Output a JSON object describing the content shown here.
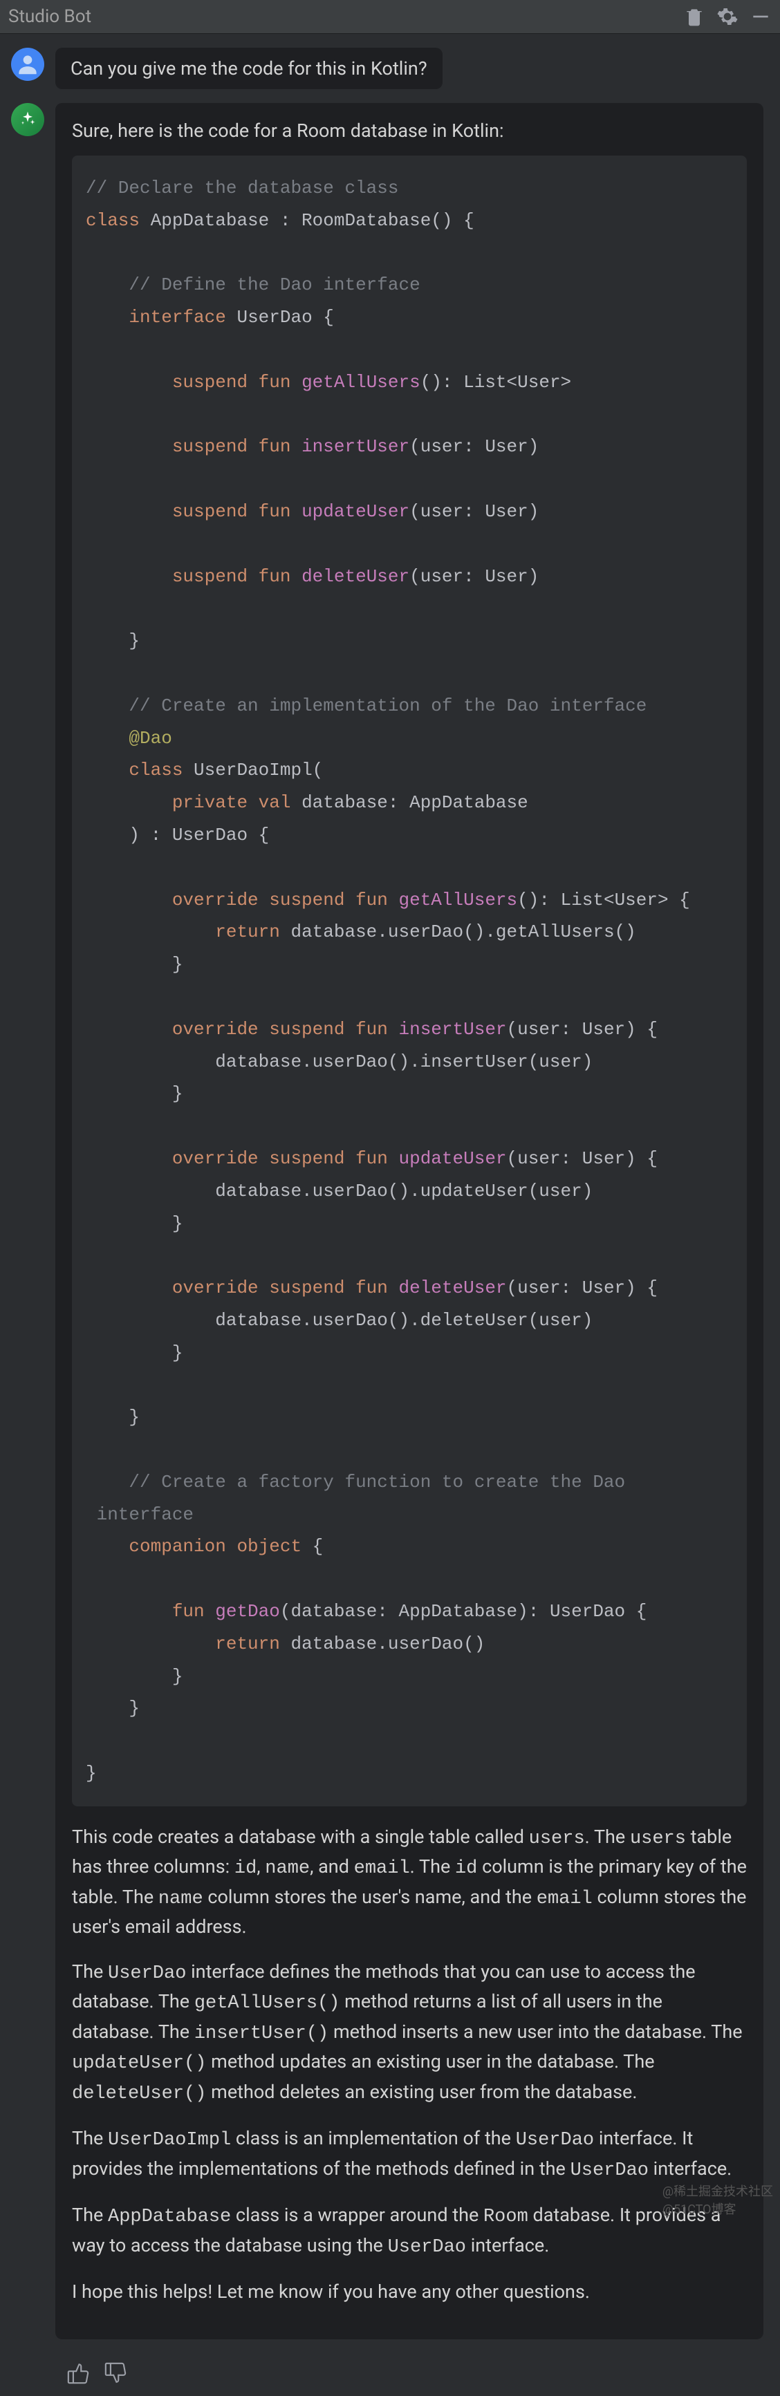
{
  "header": {
    "title": "Studio Bot"
  },
  "user": {
    "message": "Can you give me the code for this in Kotlin?"
  },
  "bot": {
    "intro": "Sure, here is the code for a Room database in Kotlin:",
    "code": {
      "l1": "// Declare the database class",
      "l2_kw": "class",
      "l2_name": "AppDatabase : RoomDatabase() {",
      "l3": "// Define the Dao interface",
      "l4_kw": "interface",
      "l4_name": "UserDao {",
      "l5_kw": "suspend fun",
      "l5_fn": "getAllUsers",
      "l5_rest": "(): List<User>",
      "l6_kw": "suspend fun",
      "l6_fn": "insertUser",
      "l6_rest": "(user: User)",
      "l7_kw": "suspend fun",
      "l7_fn": "updateUser",
      "l7_rest": "(user: User)",
      "l8_kw": "suspend fun",
      "l8_fn": "deleteUser",
      "l8_rest": "(user: User)",
      "l9": "}",
      "l10": "// Create an implementation of the Dao interface",
      "l11": "@Dao",
      "l12_kw": "class",
      "l12_name": "UserDaoImpl(",
      "l13_kw": "private val",
      "l13_rest": "database: AppDatabase",
      "l14": ") : UserDao {",
      "l15_kw": "override suspend fun",
      "l15_fn": "getAllUsers",
      "l15_rest": "(): List<User> {",
      "l16_kw": "return",
      "l16_rest": "database.userDao().getAllUsers()",
      "l17": "}",
      "l18_kw": "override suspend fun",
      "l18_fn": "insertUser",
      "l18_rest": "(user: User) {",
      "l19": "database.userDao().insertUser(user)",
      "l20": "}",
      "l21_kw": "override suspend fun",
      "l21_fn": "updateUser",
      "l21_rest": "(user: User) {",
      "l22": "database.userDao().updateUser(user)",
      "l23": "}",
      "l24_kw": "override suspend fun",
      "l24_fn": "deleteUser",
      "l24_rest": "(user: User) {",
      "l25": "database.userDao().deleteUser(user)",
      "l26": "}",
      "l27": "}",
      "l28a": "// Create a factory function to create the Dao",
      "l28b": " interface",
      "l29_kw": "companion object",
      "l29_rest": "{",
      "l30_kw": "fun",
      "l30_fn": "getDao",
      "l30_rest": "(database: AppDatabase): UserDao {",
      "l31_kw": "return",
      "l31_rest": "database.userDao()",
      "l32": "}",
      "l33": "}",
      "l34": "}"
    },
    "explanation": {
      "p1_a": "This code creates a database with a single table called ",
      "p1_b": "users",
      "p1_c": ". The ",
      "p1_d": "users",
      "p1_e": " table has three columns: ",
      "p1_f": "id",
      "p1_g": ", ",
      "p1_h": "name",
      "p1_i": ", and ",
      "p1_j": "email",
      "p1_k": ". The ",
      "p1_l": "id",
      "p1_m": " column is the primary key of the table. The ",
      "p1_n": "name",
      "p1_o": " column stores the user's name, and the ",
      "p1_p": "email",
      "p1_q": " column stores the user's email address.",
      "p2_a": "The ",
      "p2_b": "UserDao",
      "p2_c": " interface defines the methods that you can use to access the database. The ",
      "p2_d": "getAllUsers()",
      "p2_e": " method returns a list of all users in the database. The ",
      "p2_f": "insertUser()",
      "p2_g": " method inserts a new user into the database. The ",
      "p2_h": "updateUser()",
      "p2_i": " method updates an existing user in the database. The ",
      "p2_j": "deleteUser()",
      "p2_k": " method deletes an existing user from the database.",
      "p3_a": "The ",
      "p3_b": "UserDaoImpl",
      "p3_c": " class is an implementation of the ",
      "p3_d": "UserDao",
      "p3_e": " interface. It provides the implementations of the methods defined in the ",
      "p3_f": "UserDao",
      "p3_g": " interface.",
      "p4_a": "The ",
      "p4_b": "AppDatabase",
      "p4_c": " class is a wrapper around the ",
      "p4_d": "Room",
      "p4_e": " database. It provides a way to access the database using the ",
      "p4_f": "UserDao",
      "p4_g": " interface.",
      "p5": "I hope this helps! Let me know if you have any other questions."
    }
  },
  "watermark": {
    "line1": "@稀土掘金技术社区",
    "line2": "@51CTO博客"
  }
}
